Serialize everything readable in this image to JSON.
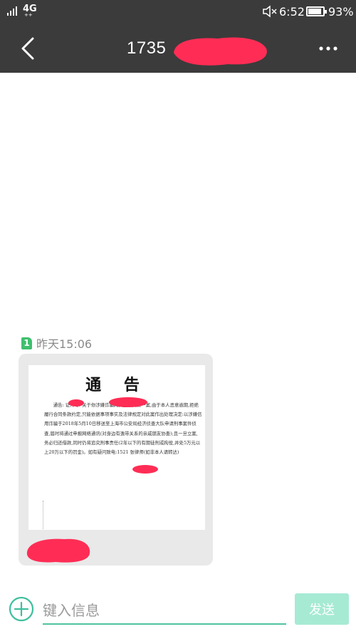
{
  "status_bar": {
    "network": "4G",
    "network_sub": "++",
    "time": "6:52",
    "battery": "93%",
    "battery_level": 0.93,
    "icons": [
      "signal-icon",
      "mute-icon",
      "battery-icon"
    ]
  },
  "header": {
    "title": "1735",
    "icons": [
      "back-arrow-icon",
      "more-options-icon"
    ]
  },
  "message": {
    "sim_label": "1",
    "timestamp": "昨天15:06",
    "image": {
      "title": "通 告",
      "body": "通告:      证件号:           关于你涉嫌诈骗网贷金额欠款一案,由于本人恶意逾期,拒绝履行合同条款约定,只能依据事项事实及法律规定对此案作出处理决定:以涉嫌信用诈骗于2018年5月10日移送至上海市公安局经济侦查大队申请刑事案件侦查,届时将通过申报网络通讯(对身边有逸带关系的亲戚朋友协查);且一旦立案,务必归还借款,同时仍将追究刑事责任(2年以下的有期徒刑或拘役,并处5万元以上20万以下的罚金)。如有疑问致电:1521        张律师(如非本人请转达)"
    }
  },
  "input_bar": {
    "placeholder": "键入信息",
    "send_label": "发送"
  },
  "colors": {
    "bar_background": "#3b3b3b",
    "redaction": "#ff2d55",
    "sim_badge": "#3fbf6e",
    "send_button": "#a6ead4",
    "input_underline": "#4fc3a1"
  }
}
